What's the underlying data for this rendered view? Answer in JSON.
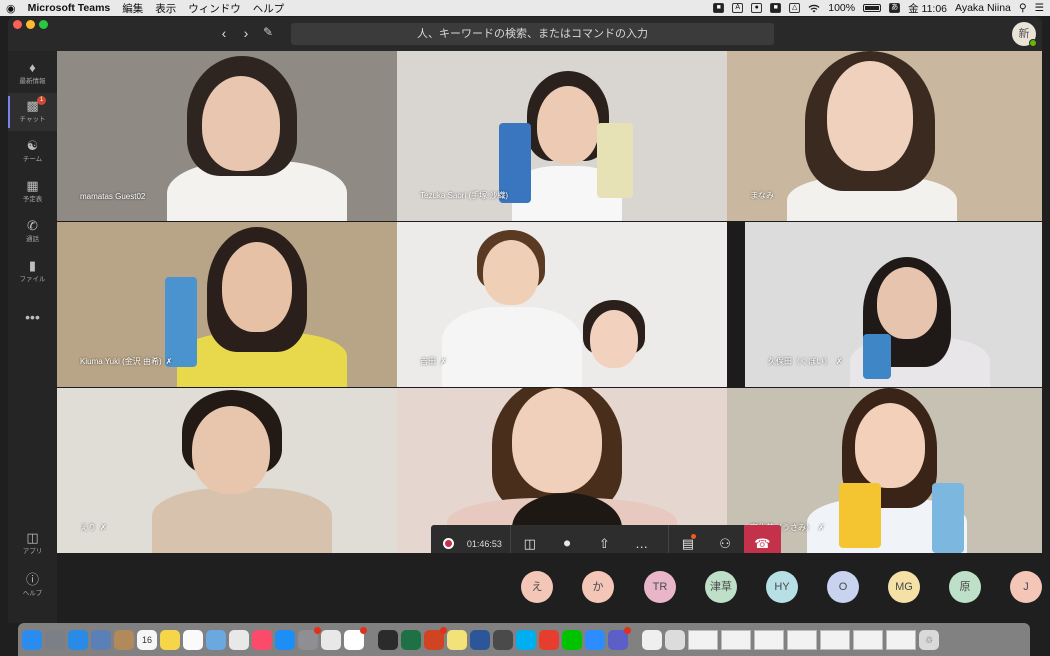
{
  "menubar": {
    "apple": "",
    "app_name": "Microsoft Teams",
    "menus": [
      "編集",
      "表示",
      "ウィンドウ",
      "ヘルプ"
    ],
    "battery": "100%",
    "status_char": "あ",
    "clock": "金 11:06",
    "user": "Ayaka Niina"
  },
  "titlebar": {
    "search_placeholder": "人、キーワードの検索、またはコマンドの入力",
    "avatar": "新"
  },
  "rail": {
    "items": [
      {
        "label": "最新情報",
        "icon": "bell-icon"
      },
      {
        "label": "チャット",
        "icon": "chat-icon",
        "badge": "1"
      },
      {
        "label": "チーム",
        "icon": "teams-icon"
      },
      {
        "label": "予定表",
        "icon": "calendar-icon"
      },
      {
        "label": "通話",
        "icon": "phone-icon"
      },
      {
        "label": "ファイル",
        "icon": "file-icon"
      }
    ],
    "more": "•••",
    "bottom": [
      {
        "label": "アプリ",
        "icon": "apps-icon"
      },
      {
        "label": "ヘルプ",
        "icon": "help-icon"
      }
    ]
  },
  "tiles": [
    {
      "label": "mamatas Guest02",
      "muted": false,
      "bg": "#8f8a84"
    },
    {
      "label": "Tezuka Saori (手塚 沙織)",
      "muted": false,
      "bg": "#d9d6d1"
    },
    {
      "label": "まなみ",
      "muted": false,
      "bg": "#c9b79f"
    },
    {
      "label": "Kiuma Yuki (金沢 由希)",
      "muted": true,
      "bg": "#b8a487"
    },
    {
      "label": "吉田",
      "muted": true,
      "bg": "#ecebe9"
    },
    {
      "label": "久保田（くぼい）",
      "muted": true,
      "bg": "#dcdcdc"
    },
    {
      "label": "えり",
      "muted": true,
      "bg": "#e0ddd6"
    },
    {
      "label": "",
      "muted": false,
      "bg": "#e5d7cf"
    },
    {
      "label": "宇佐美（うさみ）",
      "muted": true,
      "bg": "#c7c1b3"
    }
  ],
  "controls": {
    "timer": "01:46:53"
  },
  "roster": [
    {
      "initials": "え",
      "color": "#f4c6b8"
    },
    {
      "initials": "か",
      "color": "#f4c6b8"
    },
    {
      "initials": "TR",
      "color": "#e9b6c9"
    },
    {
      "initials": "津草",
      "color": "#bfe0c8"
    },
    {
      "initials": "HY",
      "color": "#b7e0e6"
    },
    {
      "initials": "O",
      "color": "#c7d3ef"
    },
    {
      "initials": "MG",
      "color": "#f5e1a6"
    },
    {
      "initials": "原",
      "color": "#bfe0c8"
    },
    {
      "initials": "J",
      "color": "#f4c6b8"
    }
  ],
  "dock": {
    "apps": [
      {
        "icon": "finder-icon",
        "color": "#2b8cf0"
      },
      {
        "icon": "launchpad-icon",
        "color": "#7b7f86"
      },
      {
        "icon": "safari-icon",
        "color": "#2a8ae8"
      },
      {
        "icon": "photo-preview-icon",
        "color": "#5b80b8"
      },
      {
        "icon": "contacts-icon",
        "color": "#b08a5a"
      },
      {
        "icon": "calendar-icon",
        "color": "#f6f6f6",
        "text": "16"
      },
      {
        "icon": "notes-icon",
        "color": "#f5d64a"
      },
      {
        "icon": "reminders-icon",
        "color": "#fafafa"
      },
      {
        "icon": "photos-app-icon",
        "color": "#6aa8e0"
      },
      {
        "icon": "itunes-icon",
        "color": "#e8e8e8"
      },
      {
        "icon": "music-icon",
        "color": "#fb4a6a"
      },
      {
        "icon": "appstore-icon",
        "color": "#1c8ef5"
      },
      {
        "icon": "settings-icon",
        "color": "#8e8e93",
        "badge": true
      },
      {
        "icon": "chrome-icon",
        "color": "#e8e8e8"
      },
      {
        "icon": "slack-icon",
        "color": "#ffffff",
        "badge": true
      },
      {
        "icon": "activity-monitor-icon",
        "color": "#2b2b2b"
      },
      {
        "icon": "excel-icon",
        "color": "#1e7145"
      },
      {
        "icon": "powerpoint-icon",
        "color": "#d04423",
        "badge": true
      },
      {
        "icon": "stickies-icon",
        "color": "#f3e27a"
      },
      {
        "icon": "word-icon",
        "color": "#2b579a"
      },
      {
        "icon": "tools-icon",
        "color": "#4a4a4a"
      },
      {
        "icon": "skype-icon",
        "color": "#00aff0"
      },
      {
        "icon": "acrobat-icon",
        "color": "#e63d2e"
      },
      {
        "icon": "line-icon",
        "color": "#00c300"
      },
      {
        "icon": "zoom-icon",
        "color": "#2d8cff"
      },
      {
        "icon": "teams-dock-icon",
        "color": "#5b5fc7",
        "badge": true
      },
      {
        "icon": "textedit-icon",
        "color": "#efefef"
      },
      {
        "icon": "help-viewer-icon",
        "color": "#dcdcdc"
      }
    ],
    "trash": "trash-icon"
  }
}
